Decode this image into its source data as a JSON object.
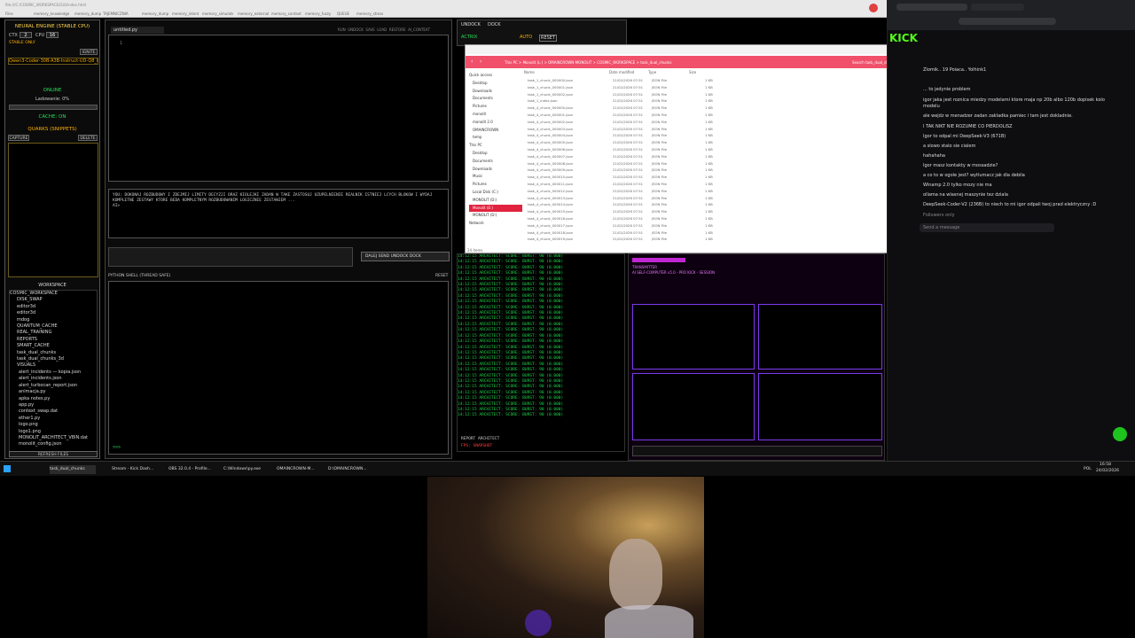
{
  "colors": {
    "accent_amber": "#ffb000",
    "accent_green": "#29e05a",
    "explorer_bar": "#f0506a",
    "kick_green": "#53fc18"
  },
  "top_strip": {
    "url_text": "file:///C:/COSMIC_WORKSPACE/GUI/index.html",
    "tabs": [
      "Files",
      "memory_knowledge",
      "memory_dump",
      "TAJEMNICZNIA",
      "memory_dump",
      "memory_intent",
      "memory_simulated",
      "memory_external",
      "memory_context",
      "memory_fuzzy",
      "QUEUE",
      "memory_stream"
    ]
  },
  "left_panel": {
    "title": "NEURAL ENGINE (STABLE CPU)",
    "ctx_label": "CTX",
    "ctx_value": "2",
    "cpu_label": "CPU",
    "cpu_value": "16",
    "stable_label": "STABLE ONLY",
    "ignite_label": "IGNITE",
    "model_name": "Qwen3-Coder-30B-A3B-Instruct-UD-Q8_K_XL",
    "status": "ONLINE",
    "loading": "Ladowanie: 0%",
    "cache": "CACHE: ON",
    "quarks_title": "QUARKS (SNIPPETS)",
    "capture": "CAPTURE",
    "delete": "DELETE",
    "workspace_title": "WORKSPACE",
    "tree": [
      "COSMIC_WORKSPACE",
      "DISK_SWAP",
      "editor3d",
      "editor3d",
      "mdog",
      "QUANTUM_CACHE",
      "REAL_TRAINING",
      "REPORTS",
      "SMART_CACHE",
      "task_dual_chunks",
      "task_dual_chunks_3d",
      "VISUALS",
      "alert_incidents — kopia.json",
      "alert_incidents.json",
      "alert_turbocan_report.json",
      "animacja.py",
      "apka notes.py",
      "app.py",
      "context_swap.dat",
      "ether1.py",
      "logo.png",
      "logo1.png",
      "MONOLIT_ARCHITECT_V8IN.dat",
      "monolit_config.json"
    ],
    "refresh": "REFRESH FILES"
  },
  "editor": {
    "tab": "untitled.py",
    "toolbar": [
      "RUN",
      "UNDOCK",
      "SAVE",
      "LOAD",
      "RESTORE",
      "AI_CONTEXT"
    ],
    "line_no": "1",
    "prompt_text": "YOU: DOKONAJ ROZBUDOWY I ZDEJMIJ LIMITY DECYZJI ORAZ KIOLEJKI ZADAN W TAKE ZASTOSUJ UZUPELNIENIE REALNIK ISTNIEJ LCYCH BLOKOW I WYDAJ KOMPLETNE ZESTAWY KTORE BEDA KOMPLETNYM ROZBUDOWANIM LOGICZNIE ZESTAWIEM ...",
    "prompt_marker": "AI>",
    "send_buttons": [
      "DALEJ",
      "SEND",
      "UNDOCK",
      "DOCK"
    ],
    "shell_title": "PYTHON SHELL (THREAD SAFE)",
    "shell_reset": "RESET",
    "shell_prompt": ">>> "
  },
  "middle": {
    "undock": "UNDOCK",
    "dock": "DOCK",
    "actrix": "ACTRIX",
    "auto": "AUTO",
    "reset": "RESET",
    "log_line": "14:12:15 ARCHITECT: SCORE: BURST: 90 (0.000)",
    "report_label": "REPORT ARCHITECT",
    "report_value": "FPS: SNAPSHOT"
  },
  "explorer": {
    "path": [
      "This PC",
      "Monolit (L:)",
      "OMAINCROWN-MONOLIT",
      "COSMIC_WORKSPACE",
      "task_dual_chunks"
    ],
    "search": "Search task_dual_chunks",
    "columns": [
      "Name",
      "Date modified",
      "Type",
      "Size"
    ],
    "sidebar": [
      "Quick access",
      "Desktop",
      "Downloads",
      "Documents",
      "Pictures",
      "monolit",
      "monolit 2.0",
      "OMAINCROWN",
      "temp",
      "This PC",
      "Desktop",
      "Documents",
      "Downloads",
      "Music",
      "Pictures",
      "Local Disk (C:)",
      "MONOLIT (D:)",
      "Monolit (E:)",
      "MONOLIT (D:)",
      "Network"
    ],
    "files": [
      "task_1_chunk_000000.json",
      "task_1_chunk_000001.json",
      "task_1_chunk_000002.json",
      "task_1_index.json",
      "task_4_chunk_000000.json",
      "task_4_chunk_000001.json",
      "task_4_chunk_000002.json",
      "task_4_chunk_000003.json",
      "task_4_chunk_000004.json",
      "task_4_chunk_000005.json",
      "task_4_chunk_000006.json",
      "task_4_chunk_000007.json",
      "task_4_chunk_000008.json",
      "task_4_chunk_000009.json",
      "task_4_chunk_000010.json",
      "task_4_chunk_000011.json",
      "task_4_chunk_000012.json",
      "task_4_chunk_000013.json",
      "task_4_chunk_000014.json",
      "task_4_chunk_000015.json",
      "task_4_chunk_000016.json",
      "task_4_chunk_000017.json",
      "task_4_chunk_000018.json",
      "task_4_chunk_000019.json"
    ],
    "date": "21/02/2026 07:51",
    "type": "JSON File",
    "size": "1 KB",
    "count": "24 items"
  },
  "chat": {
    "logo": "KICK",
    "messages": [
      "Zlomik.. 19   Poiaca..   Yolhink1",
      "... to jedynie problem",
      "igor jaka jest roznica miedzy modelami ktore maja np 20b albo 120b dopisek kolo",
      "modelu",
      "ale wejdz w menadzer zadan zakladka pamiec i tam jest dokladnie.",
      "I TAK NIKT NIE ROZUMIE CO PIERDOLISZ",
      "Igor to odpal mi DeepSeek-V3 (671B)",
      "a slowo stalo sie cialem",
      "hahahaha",
      "Igor masz kontakty w mossadzie?",
      "a co to w ogole jest? wytlumacz jak dla debila",
      "Winamp 2.0 tylko mozy nie ma",
      "ollama na wlasnej maszynie tez dziala",
      "DeepSeek-Coder-V2 (236B) to niech to mi igor odpali twoj prad elektryczny :D",
      "Followers only"
    ],
    "send_placeholder": "Send a message"
  },
  "dash": {
    "title": "TRANSMITTER",
    "sub": "AI SELF-COMPUTER v5.0 - PRO KICK - SESSION"
  },
  "taskbar": {
    "items": [
      "task_dual_chunks",
      "Stream - Kick Dash...",
      "OBS 32.0.4 - Profile...",
      "C:\\Windows\\py.exe",
      "OMAINCROWN-M...",
      "D:\\OMAINCROWN..."
    ],
    "lang": "POL",
    "time": "16:58",
    "date": "24/02/2026"
  }
}
